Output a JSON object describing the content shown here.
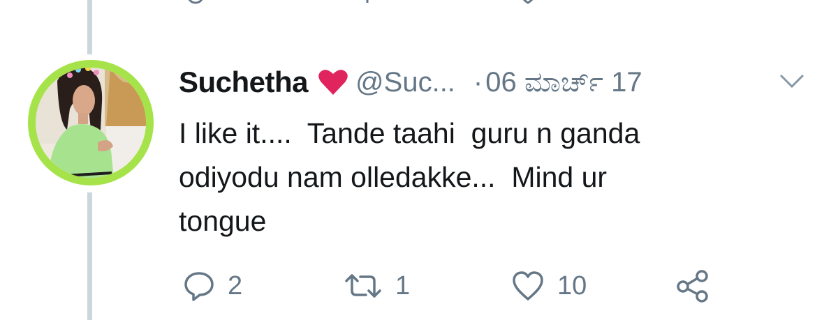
{
  "tweet": {
    "author_name": "Suchetha",
    "handle": "@Suc...",
    "separator": "·",
    "date": "06 ಮಾರ್ಚ್ 17",
    "text": "I like it....  Tande taahi  guru n ganda\nodiyodu nam olledakke...  Mind ur\ntongue",
    "icons": {
      "verified_emoji": "heart-emoji",
      "menu": "chevron-down-icon"
    }
  },
  "actions": {
    "reply_count": "2",
    "retweet_count": "1",
    "like_count": "10",
    "icons": [
      "reply-icon",
      "retweet-icon",
      "like-icon",
      "share-icon"
    ]
  },
  "colors": {
    "text_primary": "#14171a",
    "text_secondary": "#657786",
    "thread_line": "#ccd6dd",
    "heart": "#e0245e",
    "avatar_border": "#a6e34a"
  }
}
